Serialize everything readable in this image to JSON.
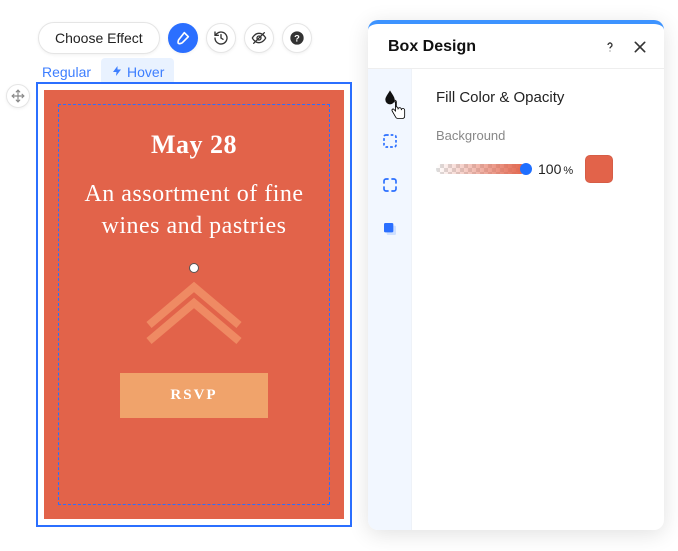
{
  "toolbar": {
    "choose_effect_label": "Choose Effect"
  },
  "tabs": {
    "regular": "Regular",
    "hover": "Hover"
  },
  "canvas": {
    "date": "May 28",
    "description": "An assortment of fine wines and pastries",
    "rsvp_label": "RSVP",
    "fill_color": "#e2634a"
  },
  "panel": {
    "title": "Box Design",
    "section_title": "Fill Color & Opacity",
    "background_label": "Background",
    "opacity_value": "100",
    "opacity_unit": "%",
    "swatch_color": "#e2634a"
  }
}
